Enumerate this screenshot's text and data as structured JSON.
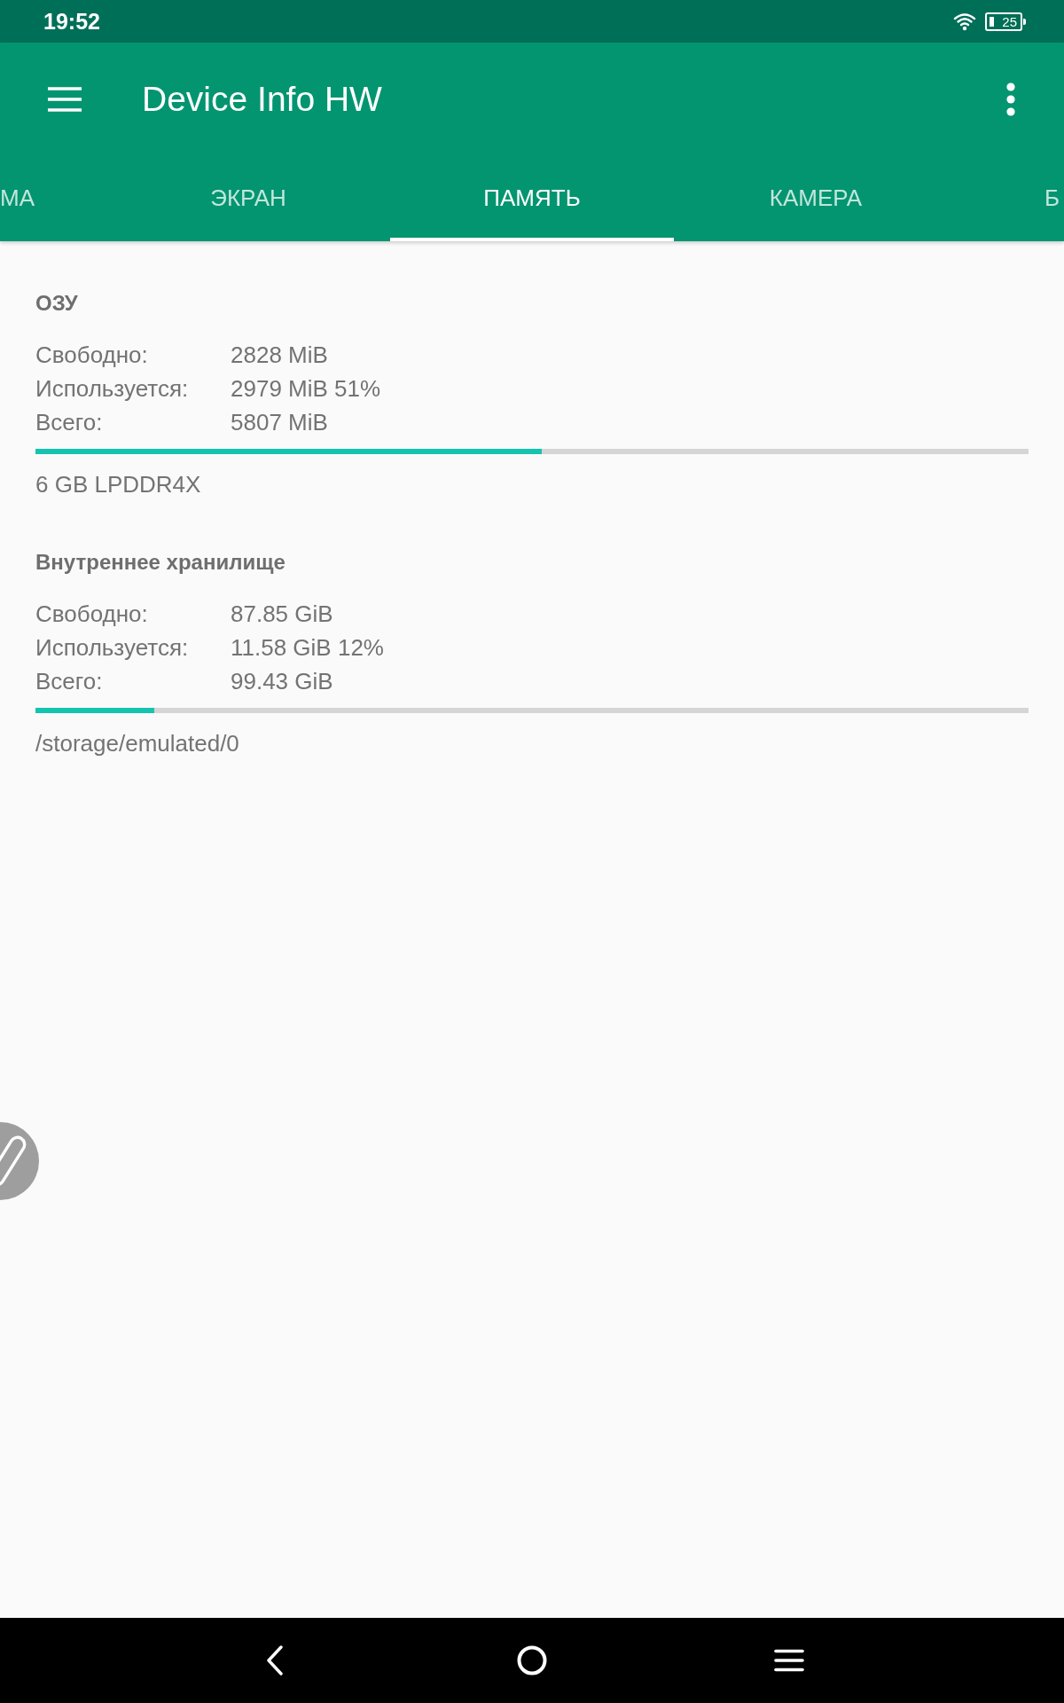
{
  "status_bar": {
    "time": "19:52",
    "battery": "25"
  },
  "app_bar": {
    "title": "Device Info HW"
  },
  "tabs": [
    {
      "label": "МА",
      "selected": false
    },
    {
      "label": "ЭКРАН",
      "selected": false
    },
    {
      "label": "ПАМЯТЬ",
      "selected": true
    },
    {
      "label": "КАМЕРА",
      "selected": false
    },
    {
      "label": "Б",
      "selected": false
    }
  ],
  "sections": [
    {
      "title": "ОЗУ",
      "rows": [
        {
          "label": "Свободно:",
          "value": "2828 MiB"
        },
        {
          "label": "Используется:",
          "value": "2979 MiB 51%"
        },
        {
          "label": "Всего:",
          "value": "5807 MiB"
        }
      ],
      "level": 0.51,
      "note": "6 GB LPDDR4X"
    },
    {
      "title": "Внутреннее хранилище",
      "rows": [
        {
          "label": "Свободно:",
          "value": "87.85 GiB"
        },
        {
          "label": "Используется:",
          "value": "11.58 GiB 12%"
        },
        {
          "label": "Всего:",
          "value": "99.43 GiB"
        }
      ],
      "level": 0.12,
      "note": "/storage/emulated/0"
    }
  ]
}
